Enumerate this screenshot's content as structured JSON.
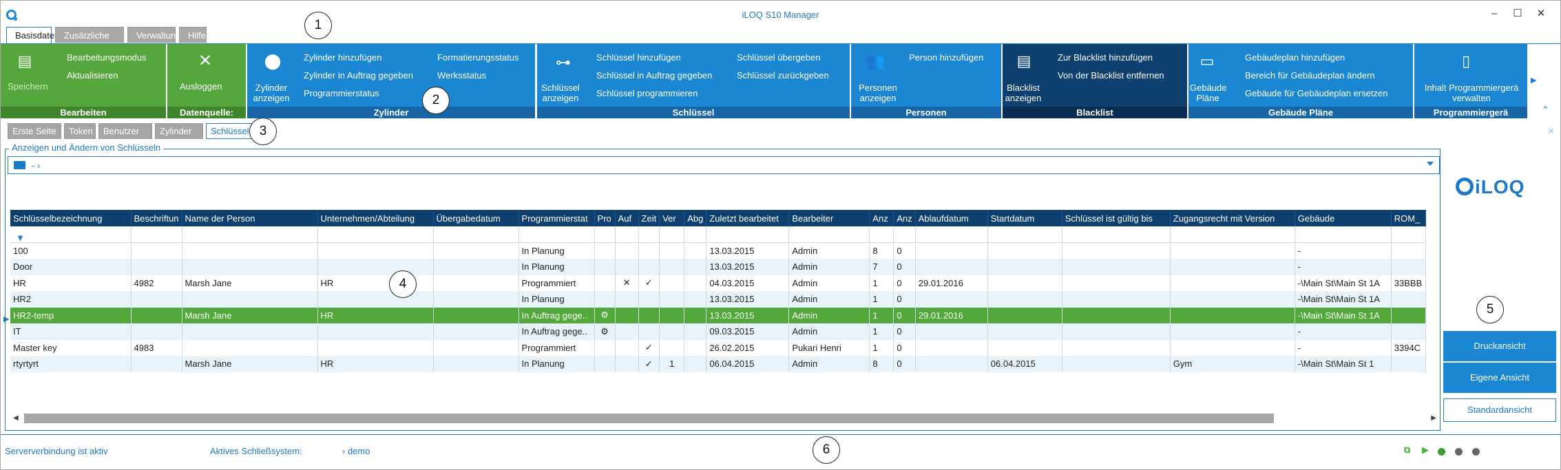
{
  "window": {
    "title": "iLOQ S10 Manager",
    "minimize": "–",
    "maximize": "☐",
    "close": "✕"
  },
  "main_tabs": [
    "Basisdaten",
    "Zusätzliche Daten",
    "Verwaltung",
    "Hilfe"
  ],
  "callouts": [
    "1",
    "2",
    "3",
    "4",
    "5",
    "6"
  ],
  "ribbon": {
    "bearbeiten": {
      "title": "Bearbeiten",
      "save": "Speichern",
      "edit_mode": "Bearbeitungsmodus",
      "refresh": "Aktualisieren"
    },
    "datenquelle": {
      "title": "Datenquelle:",
      "logout": "Ausloggen"
    },
    "zylinder": {
      "title": "Zylinder",
      "show": "Zylinder anzeigen",
      "add": "Zylinder hinzufügen",
      "order": "Zylinder in Auftrag gegeben",
      "prog_status": "Programmierstatus",
      "format_status": "Formatierungsstatus",
      "factory_status": "Werksstatus"
    },
    "schluessel": {
      "title": "Schlüssel",
      "show": "Schlüssel anzeigen",
      "add": "Schlüssel hinzufügen",
      "order": "Schlüssel in Auftrag gegeben",
      "program": "Schlüssel programmieren",
      "handover": "Schlüssel übergeben",
      "return": "Schlüssel zurückgeben"
    },
    "personen": {
      "title": "Personen",
      "show": "Personen anzeigen",
      "add": "Person hinzufügen"
    },
    "blacklist": {
      "title": "Blacklist",
      "show": "Blacklist anzeigen",
      "add": "Zur Blacklist hinzufügen",
      "remove": "Von der Blacklist entfernen"
    },
    "gebaeude": {
      "title": "Gebäude Pläne",
      "show": "Gebäude Pläne",
      "add": "Gebäudeplan hinzufügen",
      "change_area": "Bereich für Gebäudeplan ändern",
      "replace": "Gebäude für Gebäudeplan ersetzen"
    },
    "programmierger": {
      "title": "Programmiergerä",
      "manage": "Inhalt Programmiergerä verwalten"
    }
  },
  "sub_tabs": [
    "Erste Seite",
    "Token",
    "Benutzer",
    "Zylinder",
    "Schlüssel"
  ],
  "frame_title": "Anzeigen und Ändern von Schlüsseln",
  "path": "-  ›",
  "columns": [
    "Schlüsselbezeichnung",
    "Beschriftun",
    "Name der Person",
    "Unternehmen/Abteilung",
    "Übergabedatum",
    "Programmierstat",
    "Pro",
    "Auf",
    "Zeit",
    "Ver",
    "Abg",
    "Zuletzt bearbeitet",
    "Bearbeiter",
    "Anz",
    "Anz",
    "Ablaufdatum",
    "Startdatum",
    "Schlüssel ist gültig bis",
    "Zugangsrecht mit Version",
    "Gebäude",
    "ROM_"
  ],
  "rows": [
    [
      "100",
      "",
      "",
      "",
      "",
      "In Planung",
      "",
      "",
      "",
      "",
      "",
      "13.03.2015",
      "Admin",
      "8",
      "0",
      "",
      "",
      "",
      "",
      "-",
      ""
    ],
    [
      "Door",
      "",
      "",
      "",
      "",
      "In Planung",
      "",
      "",
      "",
      "",
      "",
      "13.03.2015",
      "Admin",
      "7",
      "0",
      "",
      "",
      "",
      "",
      "-",
      ""
    ],
    [
      "HR",
      "4982",
      "Marsh Jane",
      "HR",
      "",
      "Programmiert",
      "",
      "✕",
      "✓",
      "",
      "",
      "04.03.2015",
      "Admin",
      "1",
      "0",
      "29.01.2016",
      "",
      "",
      "",
      "-\\Main St\\Main St 1A",
      "33BBB"
    ],
    [
      "HR2",
      "",
      "",
      "",
      "",
      "In Planung",
      "",
      "",
      "",
      "",
      "",
      "13.03.2015",
      "Admin",
      "1",
      "0",
      "",
      "",
      "",
      "",
      "-\\Main St\\Main St 1A",
      ""
    ],
    [
      "HR2-temp",
      "",
      "Marsh Jane",
      "HR",
      "",
      "In Auftrag gege..",
      "⚙",
      "",
      "",
      "",
      "",
      "13.03.2015",
      "Admin",
      "1",
      "0",
      "29.01.2016",
      "",
      "",
      "",
      "-\\Main St\\Main St 1A",
      ""
    ],
    [
      "IT",
      "",
      "",
      "",
      "",
      "In Auftrag gege..",
      "⚙",
      "",
      "",
      "",
      "",
      "09.03.2015",
      "Admin",
      "1",
      "0",
      "",
      "",
      "",
      "",
      "-",
      ""
    ],
    [
      "Master key",
      "4983",
      "",
      "",
      "",
      "Programmiert",
      "",
      "",
      "✓",
      "",
      "",
      "26.02.2015",
      "Pukari Henri",
      "1",
      "0",
      "",
      "",
      "",
      "",
      "-",
      "3394C"
    ],
    [
      "rtyrtyrt",
      "",
      "Marsh Jane",
      "HR",
      "",
      "In Planung",
      "",
      "",
      "✓",
      "1",
      "",
      "06.04.2015",
      "Admin",
      "8",
      "0",
      "",
      "06.04.2015",
      "",
      "Gym",
      "-\\Main St\\Main St 1",
      ""
    ]
  ],
  "selected_row": 4,
  "side": {
    "brand": "iLOQ",
    "print_view": "Druckansicht",
    "own_view": "Eigene Ansicht",
    "standard_view": "Standardansicht"
  },
  "status": {
    "connection": "Serververbindung ist aktiv",
    "system_label": "Aktives Schließsystem:",
    "system_value": "› demo"
  }
}
